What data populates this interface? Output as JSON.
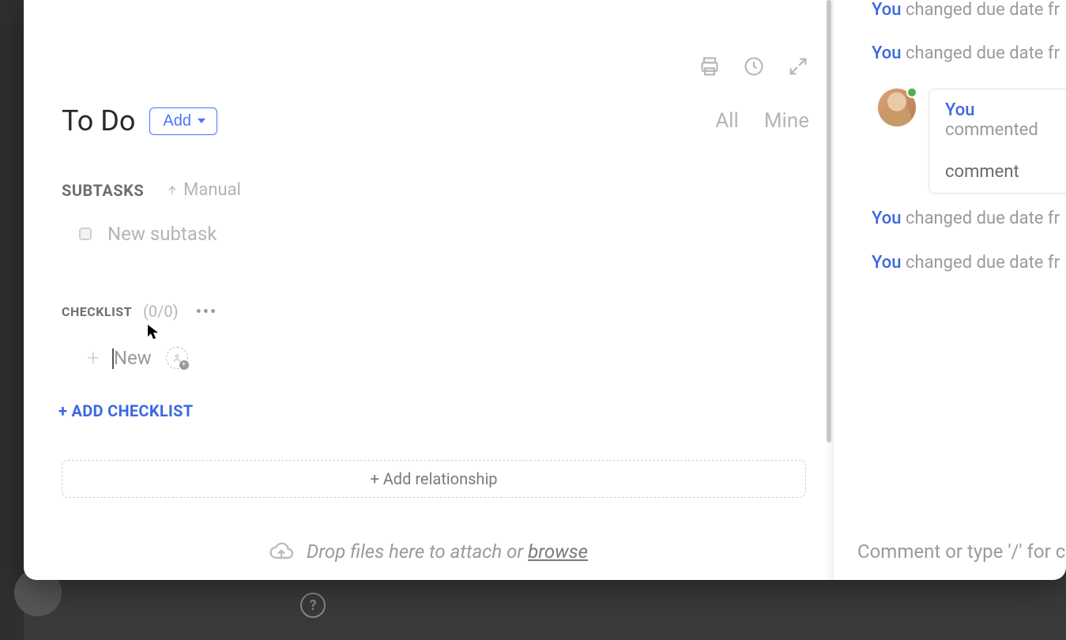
{
  "header": {
    "title": "To Do",
    "add_label": "Add"
  },
  "filters": {
    "all": "All",
    "mine": "Mine"
  },
  "subtasks": {
    "label": "SUBTASKS",
    "sort": "Manual",
    "placeholder": "New subtask"
  },
  "checklist": {
    "label": "CHECKLIST",
    "count": "(0/0)",
    "new_text": "New",
    "add_link": "+ ADD CHECKLIST"
  },
  "relationship": {
    "label": "+ Add relationship"
  },
  "dropzone": {
    "text": "Drop files here to attach or ",
    "browse": "browse"
  },
  "activity": {
    "items": [
      "changed due date fr",
      "changed due date fr",
      "changed due date fr",
      "changed due date fr"
    ],
    "you": "You",
    "comment_header": "commented",
    "comment_body": "comment"
  },
  "comment_input": {
    "placeholder": "Comment or type '/' for c"
  },
  "icons": {
    "print": "print-icon",
    "history": "history-icon",
    "expand": "expand-icon"
  }
}
